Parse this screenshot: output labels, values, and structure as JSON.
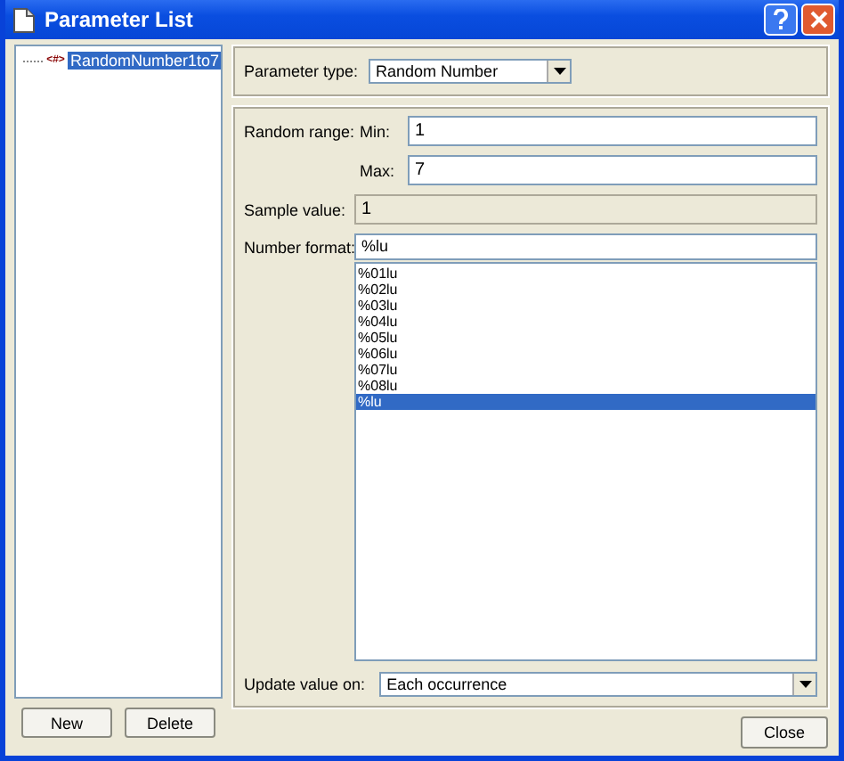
{
  "window": {
    "title": "Parameter List"
  },
  "tree": {
    "items": [
      {
        "icon": "<#>",
        "label": "RandomNumber1to7",
        "selected": true
      }
    ]
  },
  "left_buttons": [
    "New",
    "Delete"
  ],
  "parameter_type": {
    "label": "Parameter type:",
    "value": "Random Number"
  },
  "random_range": {
    "label": "Random range:",
    "min_label": "Min:",
    "min_value": "1",
    "max_label": "Max:",
    "max_value": "7"
  },
  "sample_value": {
    "label": "Sample value:",
    "value": "1",
    "disabled": true
  },
  "number_format": {
    "label": "Number format:",
    "value": "%lu",
    "options": [
      {
        "label": "%01lu",
        "selected": false
      },
      {
        "label": "%02lu",
        "selected": false
      },
      {
        "label": "%03lu",
        "selected": false
      },
      {
        "label": "%04lu",
        "selected": false
      },
      {
        "label": "%05lu",
        "selected": false
      },
      {
        "label": "%06lu",
        "selected": false
      },
      {
        "label": "%07lu",
        "selected": false
      },
      {
        "label": "%08lu",
        "selected": false
      },
      {
        "label": "%lu",
        "selected": true
      }
    ]
  },
  "update_value_on": {
    "label": "Update value on:",
    "value": "Each occurrence"
  },
  "buttons": [
    "Close"
  ]
}
